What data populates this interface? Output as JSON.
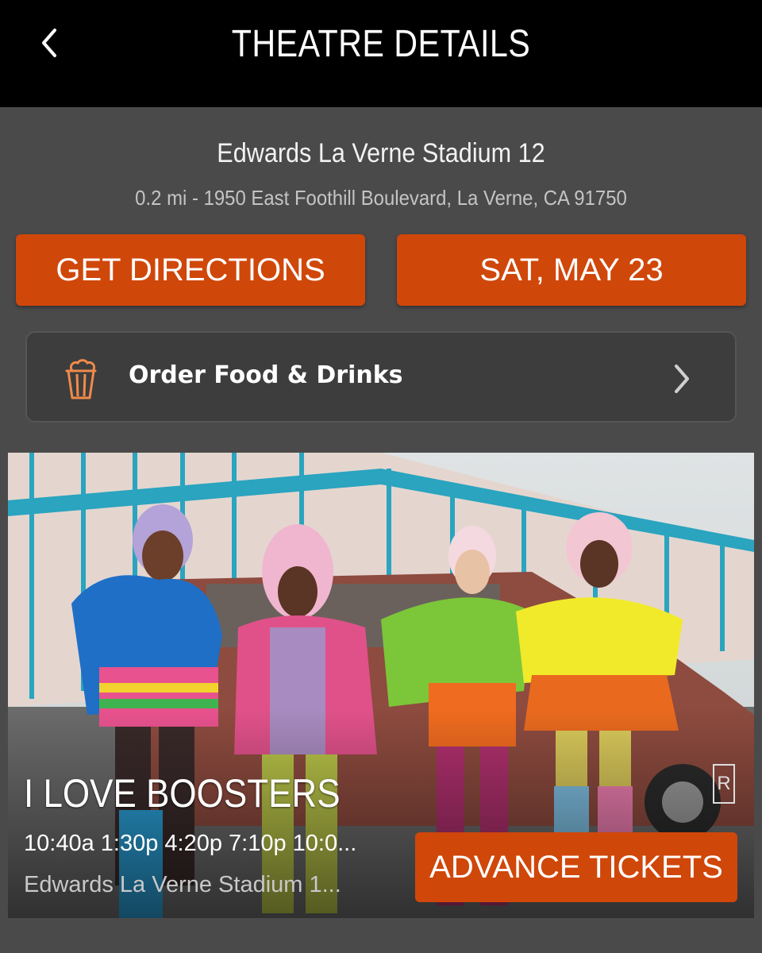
{
  "header": {
    "title": "THEATRE DETAILS",
    "back_icon": "chevron-left-icon"
  },
  "theatre": {
    "name": "Edwards La Verne Stadium 12",
    "address": "0.2 mi - 1950 East Foothill Boulevard, La Verne, CA 91750"
  },
  "actions": {
    "directions_label": "GET DIRECTIONS",
    "date_label": "SAT, MAY 23"
  },
  "food": {
    "label": "Order Food & Drinks",
    "icon": "popcorn-icon",
    "chevron": "chevron-right-icon"
  },
  "movie": {
    "title": "I LOVE BOOSTERS",
    "rating": "R",
    "showtimes": "10:40a 1:30p 4:20p 7:10p 10:0...",
    "theatre": "Edwards La Verne Stadium 1...",
    "tickets_label": "ADVANCE TICKETS"
  },
  "colors": {
    "accent": "#d0470a",
    "background": "#4a4a4a",
    "header_bg": "#000000"
  }
}
